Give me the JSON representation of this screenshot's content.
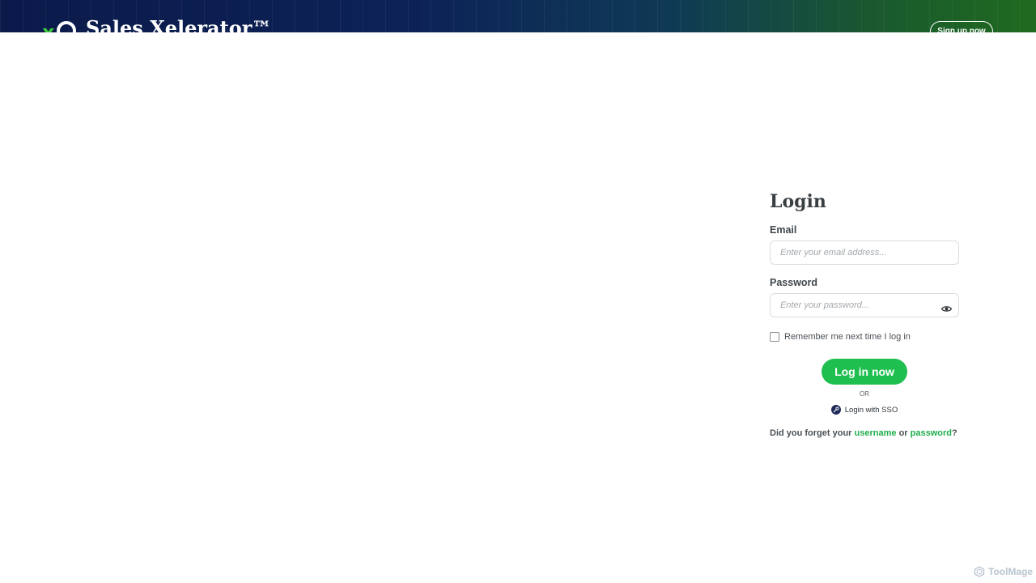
{
  "header": {
    "logo_letter": "x",
    "app_title": "Sales Xelerator™",
    "signup_label": "Sign up now"
  },
  "login": {
    "title": "Login",
    "email_label": "Email",
    "email_placeholder": "Enter your email address...",
    "password_label": "Password",
    "password_placeholder": "Enter your password...",
    "remember_label": "Remember me next time I log in",
    "submit_label": "Log in now",
    "or_text": "OR",
    "sso_label": "Login with SSO",
    "forgot_prefix": "Did you forget your",
    "forgot_username": "username",
    "forgot_or": "or",
    "forgot_password": "password",
    "forgot_suffix": "?"
  },
  "watermark": {
    "text": "ToolMage"
  },
  "colors": {
    "accent_green": "#1fbf4f",
    "header_navy": "#0b1a4a",
    "text_dark": "#3a3f44"
  },
  "icons": {
    "eye": "eye-icon",
    "sso": "key-icon",
    "logo": "xio-logo-icon"
  }
}
